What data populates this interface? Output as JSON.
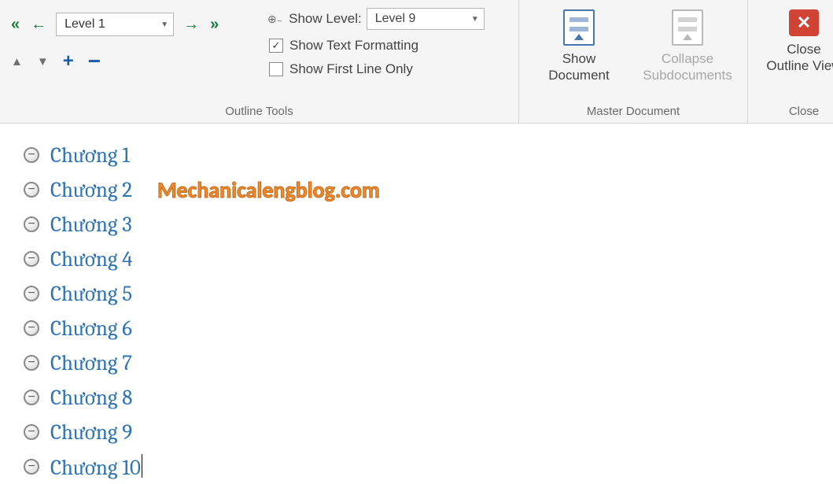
{
  "outline_tools": {
    "level_combo": "Level 1",
    "show_level_label": "Show Level:",
    "show_level_value": "Level 9",
    "show_text_formatting": "Show Text Formatting",
    "show_first_line_only": "Show First Line Only",
    "group_label": "Outline Tools"
  },
  "master_document": {
    "show_document": "Show\nDocument",
    "collapse_subdocuments": "Collapse\nSubdocuments",
    "group_label": "Master Document"
  },
  "close": {
    "close_outline_view": "Close\nOutline View",
    "group_label": "Close"
  },
  "document": {
    "headings": [
      "Chương 1",
      "Chương 2",
      "Chương 3",
      "Chương 4",
      "Chương 5",
      "Chương 6",
      "Chương 7",
      "Chương 8",
      "Chương 9",
      "Chương 10"
    ],
    "watermark": "Mechanicalengblog.com",
    "cursor_at_index": 9
  }
}
